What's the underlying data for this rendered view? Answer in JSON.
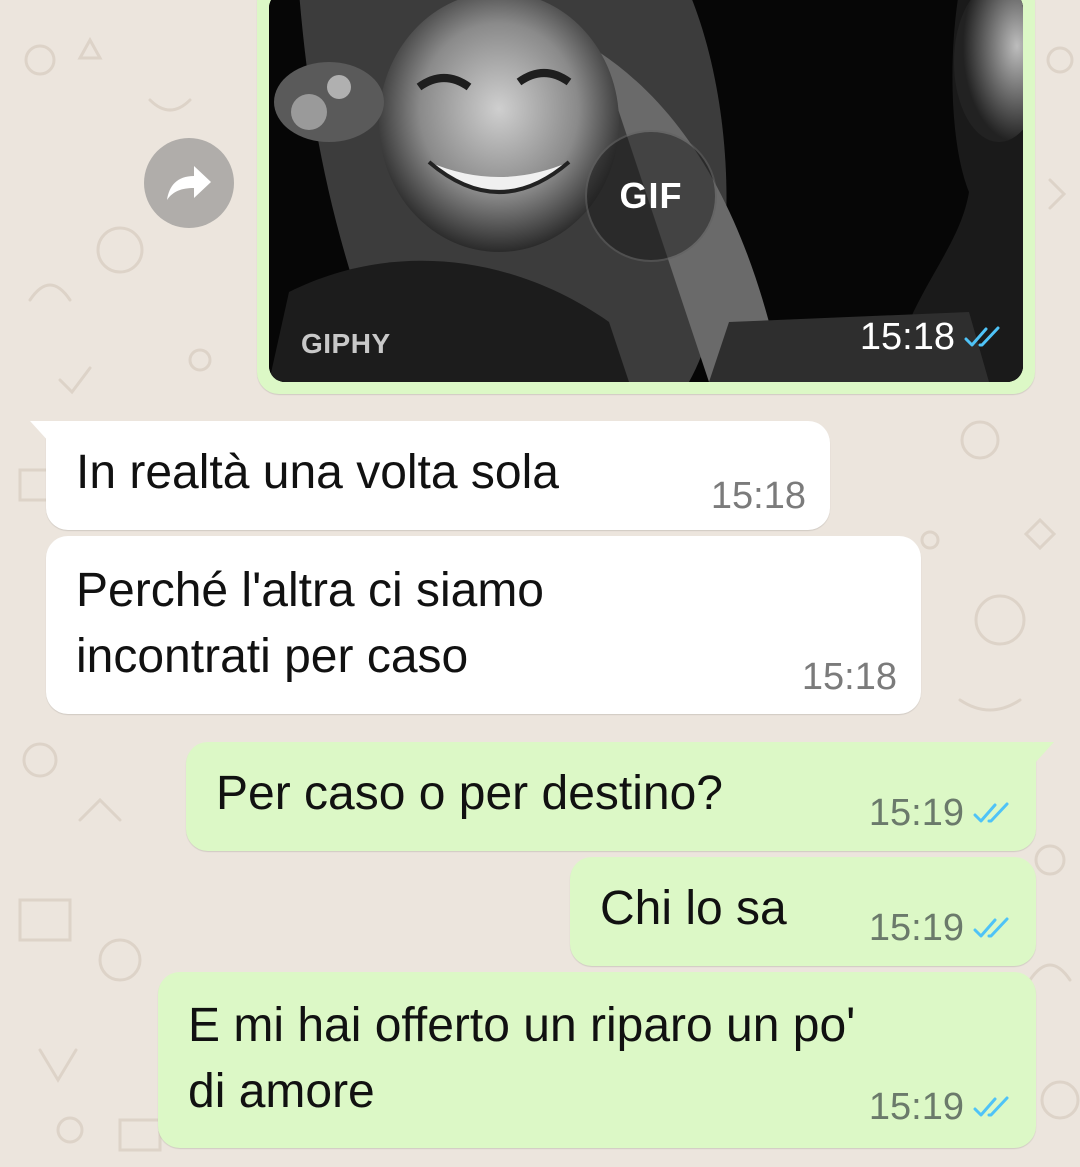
{
  "colors": {
    "wallpaper": "#ECE5DD",
    "incoming_bubble": "#FFFFFF",
    "outgoing_bubble": "#DCF8C6",
    "read_check": "#4FC3F7",
    "timestamp": "#7b7b7b"
  },
  "gif_message": {
    "badge": "GIF",
    "watermark": "GIPHY",
    "time": "15:18",
    "status": "read",
    "forward_icon": "forward-arrow-icon"
  },
  "messages": [
    {
      "direction": "incoming",
      "text": "In realtà una volta sola",
      "time": "15:18"
    },
    {
      "direction": "incoming",
      "text": "Perché l'altra ci siamo\nincontrati per caso",
      "time": "15:18"
    },
    {
      "direction": "outgoing",
      "text": "Per caso o per destino?",
      "time": "15:19",
      "status": "read"
    },
    {
      "direction": "outgoing",
      "text": "Chi lo sa",
      "time": "15:19",
      "status": "read"
    },
    {
      "direction": "outgoing",
      "text": "E mi hai offerto un riparo un po'\ndi amore",
      "time": "15:19",
      "status": "read"
    }
  ]
}
